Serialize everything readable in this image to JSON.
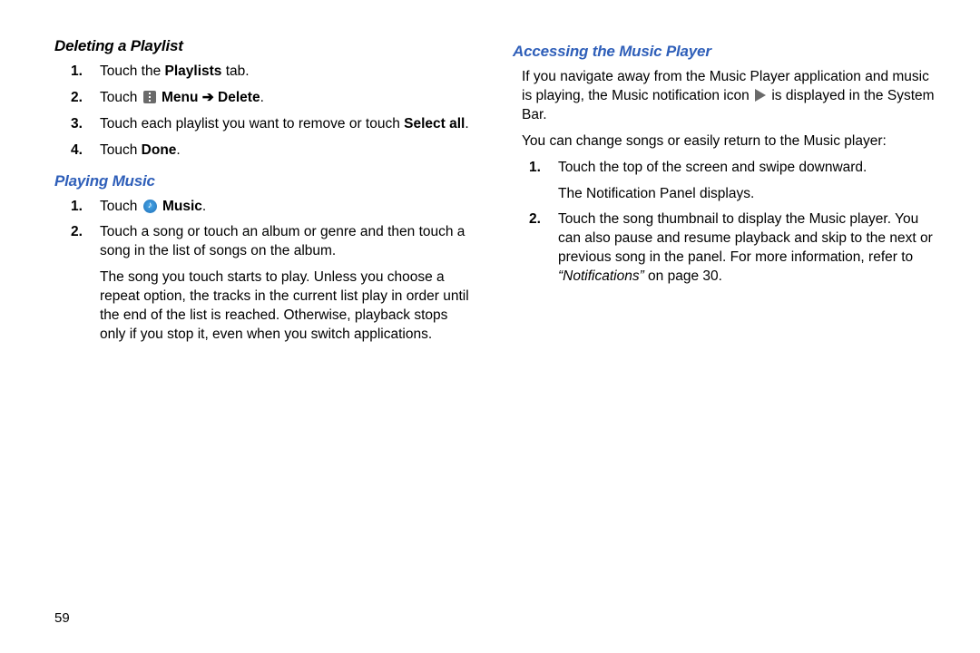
{
  "page_number": "59",
  "left": {
    "heading_deleting": "Deleting a Playlist",
    "deleting_steps": {
      "s1_pre": "Touch the ",
      "s1_bold": "Playlists",
      "s1_post": " tab.",
      "s2_pre": "Touch ",
      "s2_bold": " Menu ➔ Delete",
      "s2_post": ".",
      "s3_pre": "Touch each playlist you want to remove or touch ",
      "s3_bold": "Select all",
      "s3_post": ".",
      "s4_pre": "Touch ",
      "s4_bold": "Done",
      "s4_post": "."
    },
    "heading_playing": "Playing Music",
    "playing_steps": {
      "s1_pre": "Touch ",
      "s1_bold": " Music",
      "s1_post": ".",
      "s2_line1": "Touch a song or touch an album or genre and then touch a song in the list of songs on the album.",
      "s2_para2": "The song you touch starts to play. Unless you choose a repeat option, the tracks in the current list play in order until the end of the list is reached. Otherwise, playback stops only if you stop it, even when you switch applications."
    }
  },
  "right": {
    "heading_accessing": "Accessing the Music Player",
    "intro_pre": "If you navigate away from the Music Player application and music is playing, the Music notification icon ",
    "intro_post": " is displayed in the System Bar.",
    "change_line": "You can change songs or easily return to the Music player:",
    "steps": {
      "s1_line1": "Touch the top of the screen and swipe downward.",
      "s1_line2": "The Notification Panel displays.",
      "s2_pre": "Touch the song thumbnail to display the Music player. You can also pause and resume playback and skip to the next or previous song in the panel. For more information, refer to ",
      "s2_italic": "“Notifications”",
      "s2_post": " on page 30."
    }
  }
}
